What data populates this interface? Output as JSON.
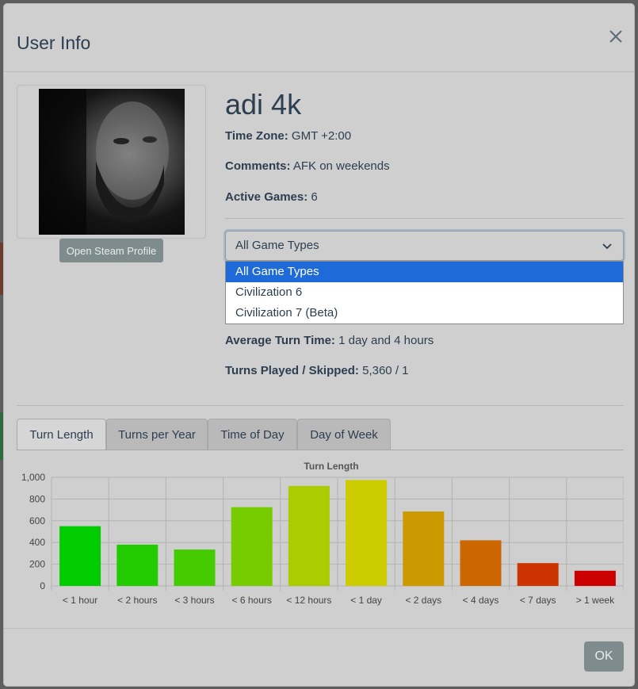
{
  "modal": {
    "title": "User Info",
    "ok_label": "OK"
  },
  "profile": {
    "name": "adi 4k",
    "steam_button": "Open Steam Profile",
    "time_zone_label": "Time Zone:",
    "time_zone": "GMT +2:00",
    "comments_label": "Comments:",
    "comments": "AFK on weekends",
    "active_games_label": "Active Games:",
    "active_games": "6",
    "avg_turn_label": "Average Turn Time:",
    "avg_turn": "1 day and 4 hours",
    "turns_label": "Turns Played / Skipped:",
    "turns": "5,360 / 1"
  },
  "game_type_select": {
    "selected": "All Game Types",
    "options": [
      "All Game Types",
      "Civilization 6",
      "Civilization 7 (Beta)"
    ]
  },
  "tabs": [
    "Turn Length",
    "Turns per Year",
    "Time of Day",
    "Day of Week"
  ],
  "chart_data": {
    "type": "bar",
    "title": "Turn Length",
    "xlabel": "",
    "ylabel": "",
    "categories": [
      "< 1 hour",
      "< 2 hours",
      "< 3 hours",
      "< 6 hours",
      "< 12 hours",
      "< 1 day",
      "< 2 days",
      "< 4 days",
      "< 7 days",
      "> 1 week"
    ],
    "values": [
      550,
      380,
      335,
      725,
      920,
      975,
      685,
      420,
      210,
      140
    ],
    "colors": [
      "#00cc00",
      "#22cc00",
      "#44cc00",
      "#77cc00",
      "#aacc00",
      "#cccc00",
      "#cc9900",
      "#cc6600",
      "#cc3300",
      "#cc0000"
    ],
    "ylim": [
      0,
      1000
    ],
    "yticks": [
      "0",
      "200",
      "400",
      "600",
      "800",
      "1,000"
    ],
    "grid": true
  }
}
